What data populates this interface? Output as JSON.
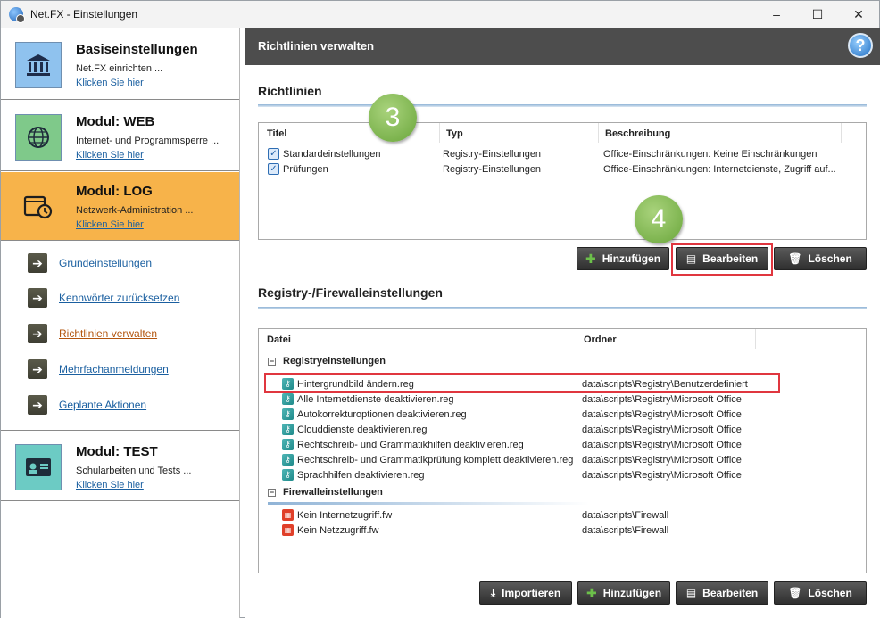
{
  "window": {
    "title": "Net.FX - Einstellungen",
    "controls": [
      "–",
      "☐",
      "✕"
    ]
  },
  "sidebar": {
    "modules": [
      {
        "title": "Basiseinstellungen",
        "desc": "Net.FX einrichten ...",
        "link": "Klicken Sie hier",
        "icon": "bank-icon"
      },
      {
        "title": "Modul: WEB",
        "desc": "Internet- und Programmsperre ...",
        "link": "Klicken Sie hier",
        "icon": "globe-icon"
      },
      {
        "title": "Modul: LOG",
        "desc": "Netzwerk-Administration ...",
        "link": "Klicken Sie hier",
        "icon": "folder-clock-icon"
      },
      {
        "title": "Modul: TEST",
        "desc": "Schularbeiten und Tests ...",
        "link": "Klicken Sie hier",
        "icon": "id-card-icon"
      }
    ],
    "sub_items": [
      "Grundeinstellungen",
      "Kennwörter zurücksetzen",
      "Richtlinien verwalten",
      "Mehrfachanmeldungen",
      "Geplante Aktionen"
    ],
    "active_sub_item": "Richtlinien verwalten",
    "active_module_color": "#f7b34a"
  },
  "main": {
    "header_title": "Richtlinien verwalten",
    "policies": {
      "section_title": "Richtlinien",
      "columns": [
        "Titel",
        "Typ",
        "Beschreibung"
      ],
      "rows": [
        {
          "title": "Standardeinstellungen",
          "type": "Registry-Einstellungen",
          "desc": "Office-Einschränkungen: Keine Einschränkungen"
        },
        {
          "title": "Prüfungen",
          "type": "Registry-Einstellungen",
          "desc": "Office-Einschränkungen: Internetdienste, Zugriff auf..."
        }
      ],
      "buttons": {
        "add": "Hinzufügen",
        "edit": "Bearbeiten",
        "delete": "Löschen"
      }
    },
    "registry": {
      "section_title": "Registry-/Firewalleinstellungen",
      "columns": [
        "Datei",
        "Ordner"
      ],
      "groups": [
        {
          "name": "Registryeinstellungen",
          "items": [
            {
              "file": "Hintergrundbild ändern.reg",
              "folder": "data\\scripts\\Registry\\Benutzerdefiniert"
            },
            {
              "file": "Alle Internetdienste deaktivieren.reg",
              "folder": "data\\scripts\\Registry\\Microsoft Office"
            },
            {
              "file": "Autokorrekturoptionen deaktivieren.reg",
              "folder": "data\\scripts\\Registry\\Microsoft Office"
            },
            {
              "file": "Clouddienste deaktivieren.reg",
              "folder": "data\\scripts\\Registry\\Microsoft Office"
            },
            {
              "file": "Rechtschreib- und Grammatikhilfen deaktivieren.reg",
              "folder": "data\\scripts\\Registry\\Microsoft Office"
            },
            {
              "file": "Rechtschreib- und Grammatikprüfung komplett deaktivieren.reg",
              "folder": "data\\scripts\\Registry\\Microsoft Office"
            },
            {
              "file": "Sprachhilfen deaktivieren.reg",
              "folder": "data\\scripts\\Registry\\Microsoft Office"
            }
          ]
        },
        {
          "name": "Firewalleinstellungen",
          "items": [
            {
              "file": "Kein Internetzugriff.fw",
              "folder": "data\\scripts\\Firewall"
            },
            {
              "file": "Kein Netzzugriff.fw",
              "folder": "data\\scripts\\Firewall"
            }
          ]
        }
      ],
      "buttons": {
        "import": "Importieren",
        "add": "Hinzufügen",
        "edit": "Bearbeiten",
        "delete": "Löschen"
      }
    }
  },
  "annotations": {
    "badge_3": "3",
    "badge_4": "4",
    "highlight_color": "#e0363f",
    "badge_color": "#7ab24a"
  }
}
